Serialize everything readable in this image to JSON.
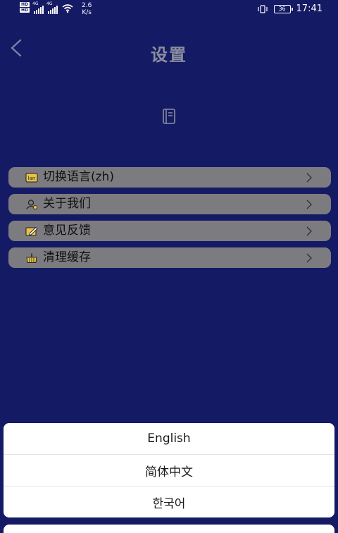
{
  "status_bar": {
    "hd1": "HD",
    "hd2": "HD",
    "net1": "4G",
    "net2": "4G",
    "speed_value": "2.6",
    "speed_unit": "K/s",
    "battery": "36",
    "time": "17:41"
  },
  "header": {
    "title": "设置",
    "back_icon": "chevron-left-icon",
    "header_icon": "notebook-icon"
  },
  "menu": {
    "items": [
      {
        "label": "切换语言(zh)",
        "icon": "language-icon"
      },
      {
        "label": "关于我们",
        "icon": "user-icon"
      },
      {
        "label": "意见反馈",
        "icon": "edit-icon"
      },
      {
        "label": "清理缓存",
        "icon": "broom-icon"
      }
    ]
  },
  "language_sheet": {
    "options": [
      "English",
      "简体中文",
      "한국어"
    ]
  },
  "colors": {
    "background": "#141a63",
    "menu_item": "#7c7c80",
    "icon_accent": "#e8c24a",
    "sheet_bg": "#ffffff"
  }
}
